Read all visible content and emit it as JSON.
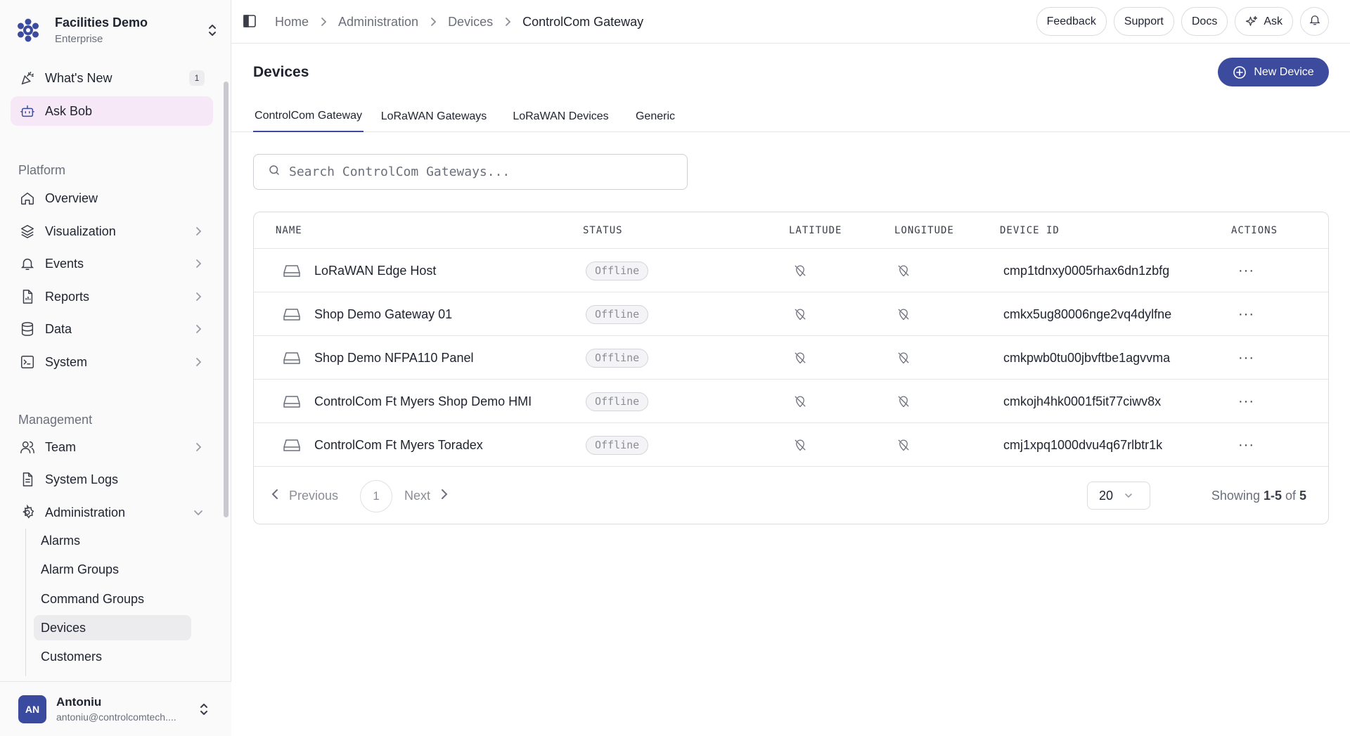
{
  "org": {
    "name": "Facilities Demo",
    "plan": "Enterprise"
  },
  "sidebar": {
    "top_items": [
      {
        "label": "What's New",
        "badge": "1"
      },
      {
        "label": "Ask Bob"
      }
    ],
    "platform_label": "Platform",
    "platform_items": [
      {
        "label": "Overview"
      },
      {
        "label": "Visualization"
      },
      {
        "label": "Events"
      },
      {
        "label": "Reports"
      },
      {
        "label": "Data"
      },
      {
        "label": "System"
      }
    ],
    "management_label": "Management",
    "management_items": [
      {
        "label": "Team"
      },
      {
        "label": "System Logs"
      },
      {
        "label": "Administration"
      }
    ],
    "admin_subitems": [
      {
        "label": "Alarms"
      },
      {
        "label": "Alarm Groups"
      },
      {
        "label": "Command Groups"
      },
      {
        "label": "Devices"
      },
      {
        "label": "Customers"
      }
    ]
  },
  "user": {
    "initials": "AN",
    "name": "Antoniu",
    "email": "antoniu@controlcomtech...."
  },
  "breadcrumb": [
    "Home",
    "Administration",
    "Devices",
    "ControlCom Gateway"
  ],
  "top_actions": {
    "feedback": "Feedback",
    "support": "Support",
    "docs": "Docs",
    "ask": "Ask"
  },
  "page": {
    "title": "Devices",
    "new_button": "New Device"
  },
  "tabs": [
    "ControlCom Gateway",
    "LoRaWAN Gateways",
    "LoRaWAN Devices",
    "Generic"
  ],
  "search": {
    "placeholder": "Search ControlCom Gateways..."
  },
  "table": {
    "columns": [
      "NAME",
      "STATUS",
      "LATITUDE",
      "LONGITUDE",
      "DEVICE ID",
      "ACTIONS"
    ],
    "rows": [
      {
        "name": "LoRaWAN Edge Host",
        "status": "Offline",
        "device_id": "cmp1tdnxy0005rhax6dn1zbfg"
      },
      {
        "name": "Shop Demo Gateway 01",
        "status": "Offline",
        "device_id": "cmkx5ug80006nge2vq4dylfne"
      },
      {
        "name": "Shop Demo NFPA110 Panel",
        "status": "Offline",
        "device_id": "cmkpwb0tu00jbvftbe1agvvma"
      },
      {
        "name": "ControlCom Ft Myers Shop Demo HMI",
        "status": "Offline",
        "device_id": "cmkojh4hk0001f5it77ciwv8x"
      },
      {
        "name": "ControlCom Ft Myers Toradex",
        "status": "Offline",
        "device_id": "cmj1xpq1000dvu4q67rlbtr1k"
      }
    ],
    "actions_glyph": "···"
  },
  "pagination": {
    "previous": "Previous",
    "page": "1",
    "next": "Next",
    "page_size": "20",
    "showing_prefix": "Showing",
    "range": "1-5",
    "of": "of",
    "total": "5"
  },
  "colors": {
    "accent": "#3d4b9e",
    "active_nav_bg": "#f6e8f7",
    "avatar_bg": "#3a4a9f"
  },
  "icons": {
    "org": "org-logo-icon",
    "whats_new": "party-popper-icon",
    "ask_bob": "bot-icon",
    "overview": "home-icon",
    "visualization": "layers-icon",
    "events": "bell-icon",
    "reports": "report-icon",
    "data": "database-icon",
    "system": "terminal-icon",
    "team": "users-icon",
    "system_logs": "file-text-icon",
    "administration": "gear-icon",
    "device": "hard-drive-icon",
    "location_off": "location-off-icon"
  }
}
